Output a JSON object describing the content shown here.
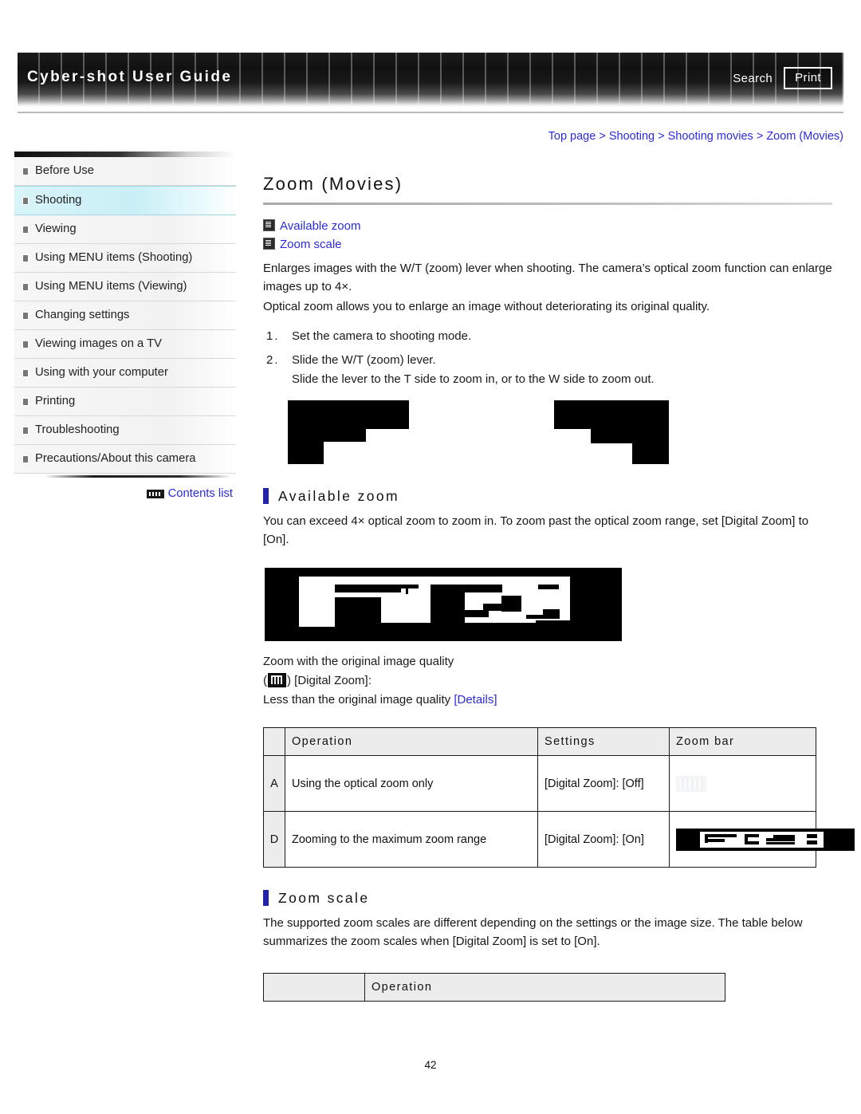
{
  "header": {
    "brand": "Cyber-shot User Guide",
    "search_label": "Search",
    "print_label": "Print"
  },
  "breadcrumb": {
    "text": "Top page > Shooting > Shooting movies > Zoom (Movies)"
  },
  "sidebar": {
    "items": [
      {
        "label": "Before Use",
        "active": false
      },
      {
        "label": "Shooting",
        "active": true
      },
      {
        "label": "Viewing",
        "active": false
      },
      {
        "label": "Using MENU items (Shooting)",
        "active": false
      },
      {
        "label": "Using MENU items (Viewing)",
        "active": false
      },
      {
        "label": "Changing settings",
        "active": false
      },
      {
        "label": "Viewing images on a TV",
        "active": false
      },
      {
        "label": "Using with your computer",
        "active": false
      },
      {
        "label": "Printing",
        "active": false
      },
      {
        "label": "Troubleshooting",
        "active": false
      },
      {
        "label": "Precautions/About this camera",
        "active": false
      }
    ],
    "contents_list_label": "Contents list"
  },
  "main": {
    "page_title": "Zoom (Movies)",
    "jump_links": [
      {
        "label": "Available zoom"
      },
      {
        "label": "Zoom scale"
      }
    ],
    "intro_paragraph_1": "Enlarges images with the W/T (zoom) lever when shooting. The camera’s optical zoom function can enlarge images up to 4×.",
    "intro_paragraph_2": "Optical zoom allows you to enlarge an image without deteriorating its original quality.",
    "steps": [
      {
        "num": "1.",
        "text": "Set the camera to shooting mode.",
        "sub": ""
      },
      {
        "num": "2.",
        "text": "Slide the W/T (zoom) lever.",
        "sub": "Slide the lever to the T side to zoom in, or to the W side to zoom out."
      }
    ],
    "section_available_zoom": {
      "heading": "Available zoom",
      "paragraph": "You can exceed 4× optical zoom to zoom in. To zoom past the optical zoom range, set [Digital Zoom] to [On].",
      "caption_line_1": "Zoom with the original image quality",
      "caption_line_2_prefix": "(",
      "caption_line_2_suffix": ") [Digital Zoom]:",
      "caption_line_3_text": "Less than the original image quality ",
      "caption_line_3_link": "[Details]"
    },
    "zoom_table": {
      "columns": [
        "",
        "Operation",
        "Settings",
        "Zoom bar"
      ],
      "rows": [
        {
          "index": "A",
          "operation": "Using the optical zoom only",
          "settings": "[Digital Zoom]: [Off]",
          "zoombar": "faint"
        },
        {
          "index": "D",
          "operation": "Zooming to the maximum zoom range",
          "settings": "[Digital Zoom]: [On]",
          "zoombar": "dark"
        }
      ]
    },
    "section_zoom_scale": {
      "heading": "Zoom scale",
      "paragraph": "The supported zoom scales are different depending on the settings or the image size. The table below summarizes the zoom scales when [Digital Zoom] is set to [On]."
    },
    "zoom_scale_table": {
      "columns": [
        "",
        "Operation"
      ]
    },
    "page_number": "42"
  },
  "colors": {
    "link": "#2b2bdd",
    "accent_bar": "#2222aa",
    "active_row": "#c9eff6"
  }
}
